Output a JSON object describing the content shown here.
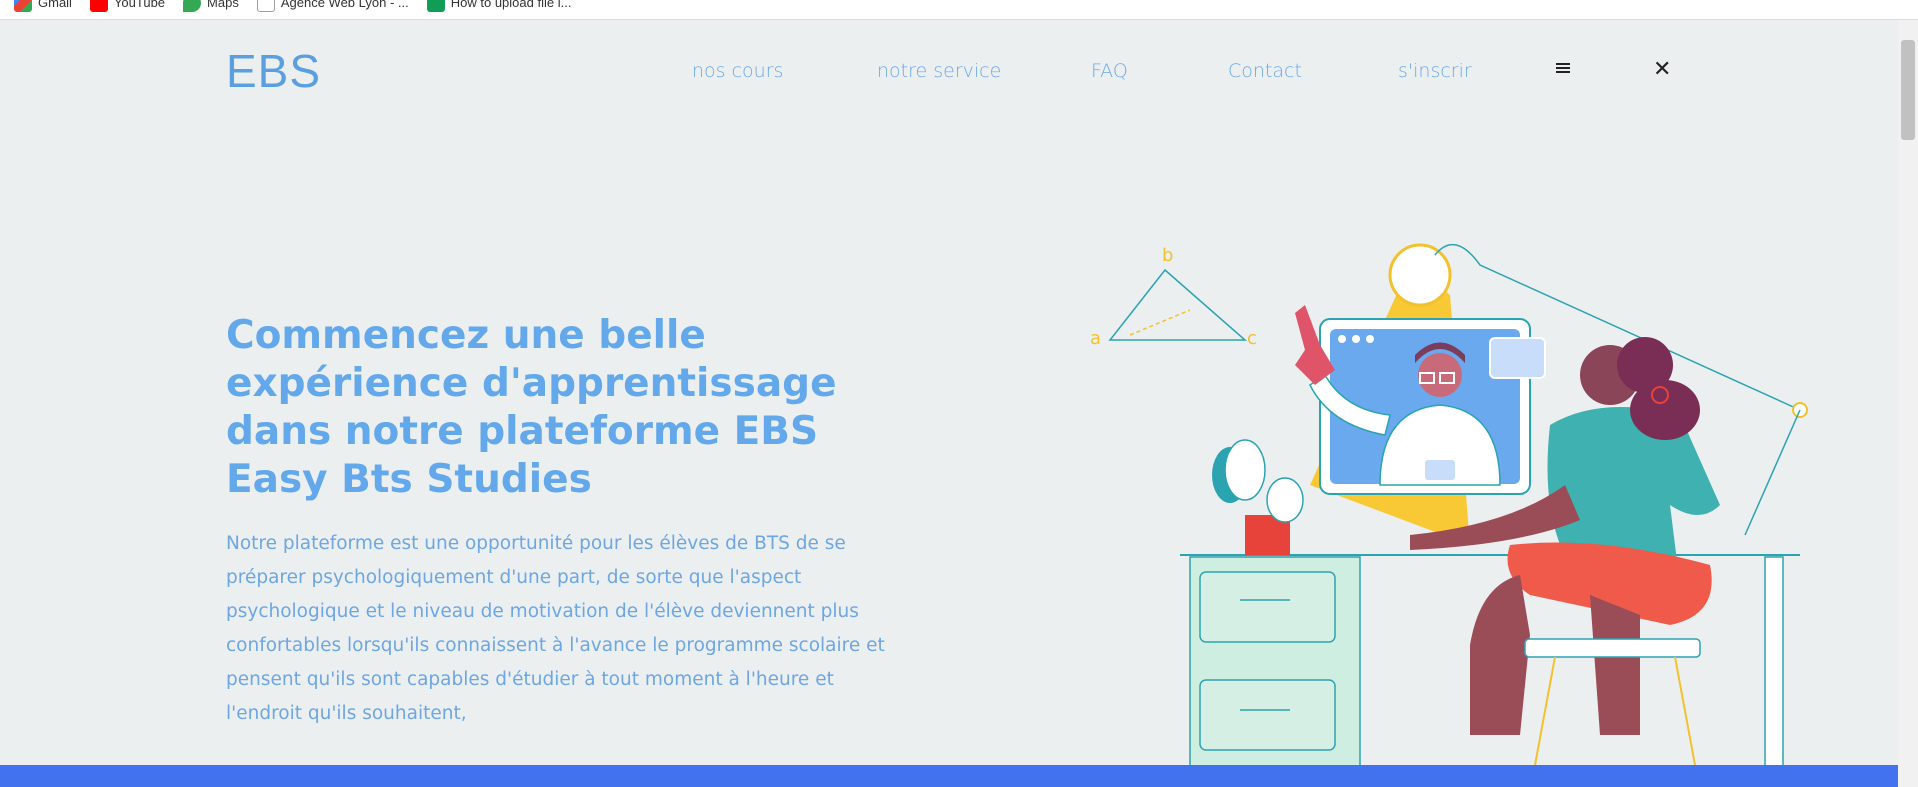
{
  "bookmarks": [
    {
      "label": "Gmail",
      "icon": "gmail-icon",
      "color": "#ea4335"
    },
    {
      "label": "YouTube",
      "icon": "youtube-icon",
      "color": "#ff0000"
    },
    {
      "label": "Maps",
      "icon": "maps-icon",
      "color": "#34a853"
    },
    {
      "label": "Agence Web Lyon - ...",
      "icon": "page-icon",
      "color": "#9aa0a6"
    },
    {
      "label": "How to upload file i...",
      "icon": "green-app-icon",
      "color": "#0f9d58"
    }
  ],
  "header": {
    "logo": "EBS",
    "nav": [
      "nos cours",
      "notre service",
      "FAQ",
      "Contact",
      "s'inscrir"
    ],
    "menu_icon": "hamburger-icon",
    "close_icon": "close-icon"
  },
  "hero": {
    "title": "Commencez une belle expérience d'apprentissage dans notre plateforme EBS Easy Bts Studies",
    "text": "Notre plateforme est une opportunité pour les élèves de BTS de se préparer psychologiquement d'une part, de sorte que l'aspect psychologique et le niveau de motivation de l'élève deviennent plus confortables lorsqu'ils connaissent à l'avance le programme scolaire et pensent qu'ils sont capables d'étudier à tout moment à l'heure et l'endroit qu'ils souhaitent,",
    "illustration": {
      "labels": [
        "b",
        "a",
        "c"
      ]
    }
  },
  "colors": {
    "accent": "#63a8ea",
    "background": "#eceff0",
    "footer": "#4272ee"
  }
}
